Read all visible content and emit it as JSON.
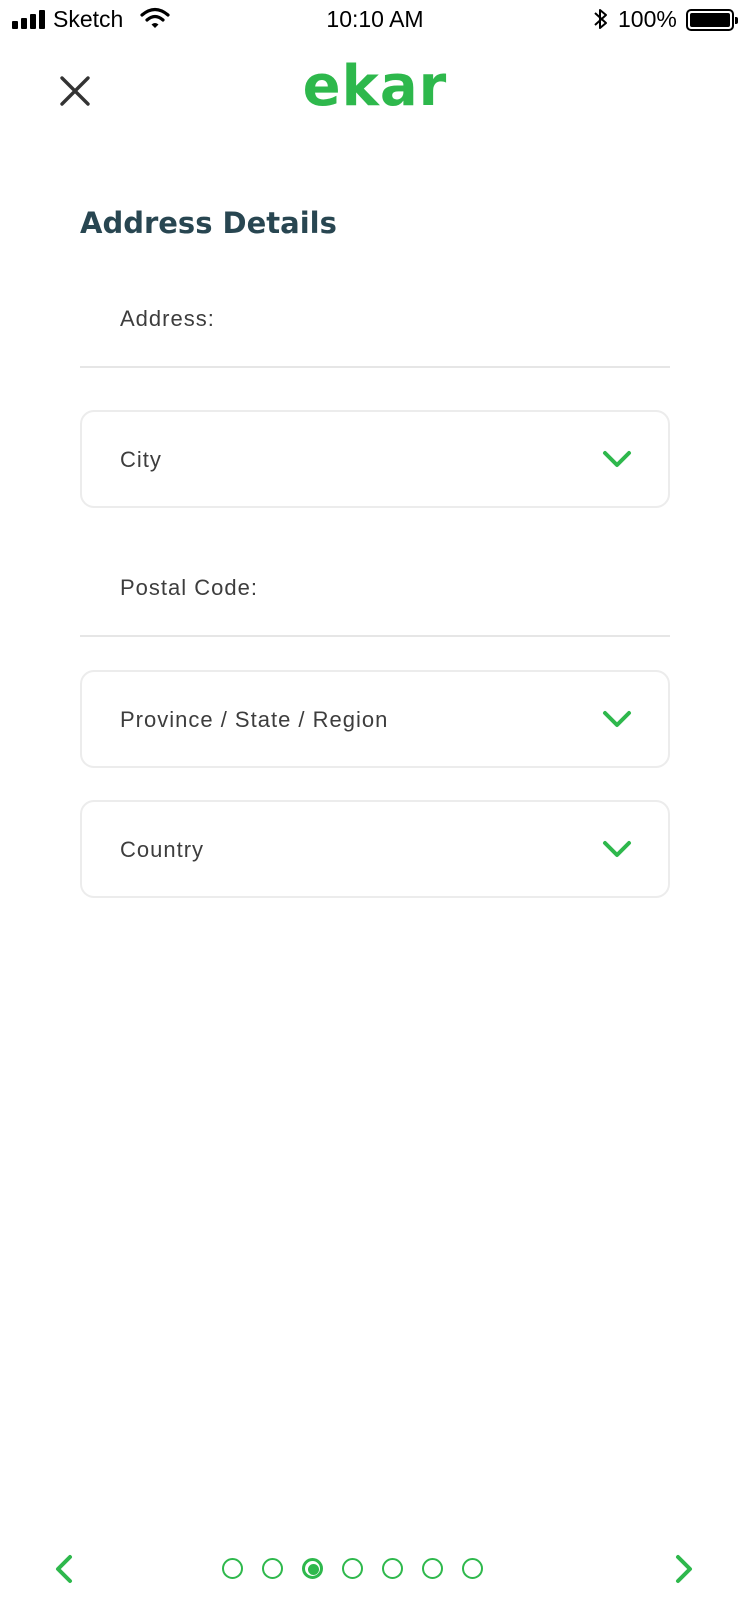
{
  "status_bar": {
    "carrier": "Sketch",
    "time": "10:10 AM",
    "battery": "100%"
  },
  "header": {
    "logo_text": "ekar",
    "close_icon": "close-icon"
  },
  "form": {
    "title": "Address Details",
    "address_label": "Address:",
    "city_label": "City",
    "postal_code_label": "Postal Code:",
    "region_label": "Province / State / Region",
    "country_label": "Country",
    "dropdown_icon": "chevron-down-icon"
  },
  "pager": {
    "total_steps": 7,
    "current_step": 3,
    "prev_icon": "chevron-left-icon",
    "next_icon": "chevron-right-icon"
  },
  "colors": {
    "accent": "#2eb84c",
    "title": "#284651",
    "text": "#3d3d3d",
    "border": "#ececec"
  }
}
